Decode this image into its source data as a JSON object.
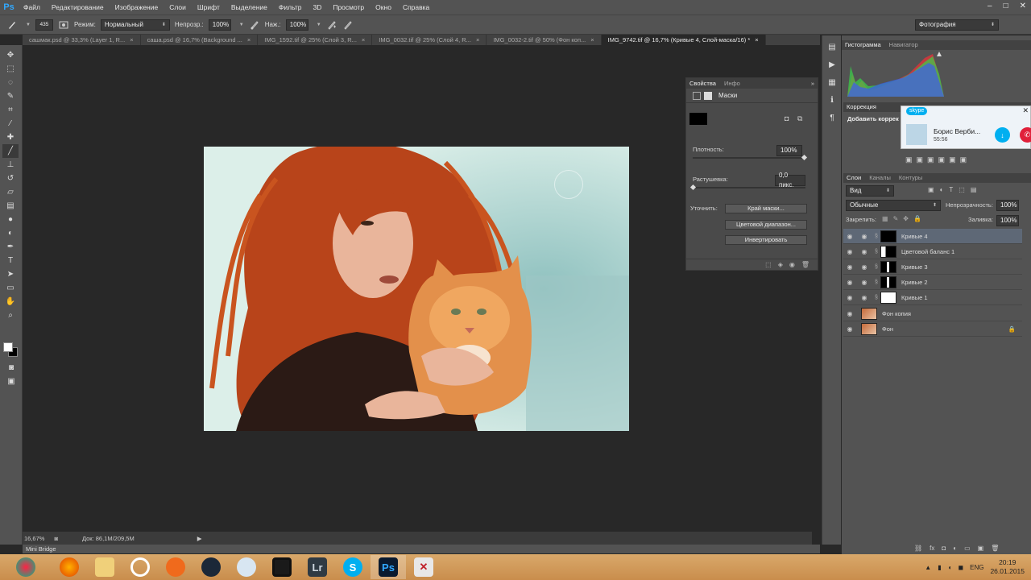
{
  "menubar": {
    "logo": "Ps",
    "items": [
      "Файл",
      "Редактирование",
      "Изображение",
      "Слои",
      "Шрифт",
      "Выделение",
      "Фильтр",
      "3D",
      "Просмотр",
      "Окно",
      "Справка"
    ],
    "win_min": "–",
    "win_max": "□",
    "win_close": "✕"
  },
  "options": {
    "brush_size": "435",
    "mode_label": "Режим:",
    "mode_value": "Нормальный",
    "opacity_label": "Непрозр.:",
    "opacity_value": "100%",
    "pressure_label": "Наж.:",
    "pressure_value": "100%",
    "workspace": "Фотография"
  },
  "tabs": [
    {
      "label": "сашмак.psd @ 33,3% (Layer 1, R...",
      "active": false
    },
    {
      "label": "саша.psd @ 16,7% (Background ...",
      "active": false
    },
    {
      "label": "IMG_1592.tif @ 25% (Слой 3, R...",
      "active": false
    },
    {
      "label": "IMG_0032.tif @ 25% (Слой 4, R...",
      "active": false
    },
    {
      "label": "IMG_0032-2.tif @ 50% (Фон коп...",
      "active": false
    },
    {
      "label": "IMG_9742.tif @ 16,7% (Кривые 4, Слой-маска/16) *",
      "active": true
    }
  ],
  "tab_close": "×",
  "properties": {
    "tab1": "Свойства",
    "tab2": "Инфо",
    "section": "Маски",
    "density_label": "Плотность:",
    "density_value": "100%",
    "feather_label": "Растушевка:",
    "feather_value": "0,0 пикс.",
    "refine_label": "Уточнить:",
    "btn_edge": "Край маски...",
    "btn_color_range": "Цветовой диапазон...",
    "btn_invert": "Инвертировать"
  },
  "histogram": {
    "tab1": "Гистограмма",
    "tab2": "Навигатор"
  },
  "correction": {
    "tab1": "Коррекция",
    "add": "Добавить коррек"
  },
  "skype": {
    "logo": "skype",
    "name": "Борис Верби...",
    "time": "55:56"
  },
  "layers_panel": {
    "tab1": "Слои",
    "tab2": "Каналы",
    "tab3": "Контуры",
    "filter": "Вид",
    "blend": "Обычные",
    "opacity_label": "Непрозрачность:",
    "opacity_value": "100%",
    "lock_label": "Закрепить:",
    "fill_label": "Заливка:",
    "fill_value": "100%",
    "layers": [
      {
        "name": "Кривые 4",
        "selected": true,
        "mask": "black"
      },
      {
        "name": "Цветовой баланс 1",
        "selected": false,
        "mask": "silhouette"
      },
      {
        "name": "Кривые 3",
        "selected": false,
        "mask": "silhouette"
      },
      {
        "name": "Кривые 2",
        "selected": false,
        "mask": "silhouette"
      },
      {
        "name": "Кривые 1",
        "selected": false,
        "mask": "white"
      },
      {
        "name": "Фон копия",
        "selected": false,
        "mask": "photo"
      },
      {
        "name": "Фон",
        "selected": false,
        "mask": "photo"
      }
    ]
  },
  "status": {
    "zoom": "16,67%",
    "doc": "Док: 86,1M/209,5M"
  },
  "minibridge": "Mini Bridge",
  "taskbar": {
    "lang": "ENG",
    "time": "20:19",
    "date": "26.01.2015",
    "apps": [
      "chrome-icon",
      "firefox-icon",
      "explorer-icon",
      "app-icon",
      "origin-icon",
      "steam-icon",
      "audio-icon",
      "monitor-icon",
      "lightroom-icon",
      "skype-icon",
      "photoshop-icon",
      "archive-icon"
    ],
    "lr": "Lr",
    "ps": "Ps",
    "s": "S"
  }
}
